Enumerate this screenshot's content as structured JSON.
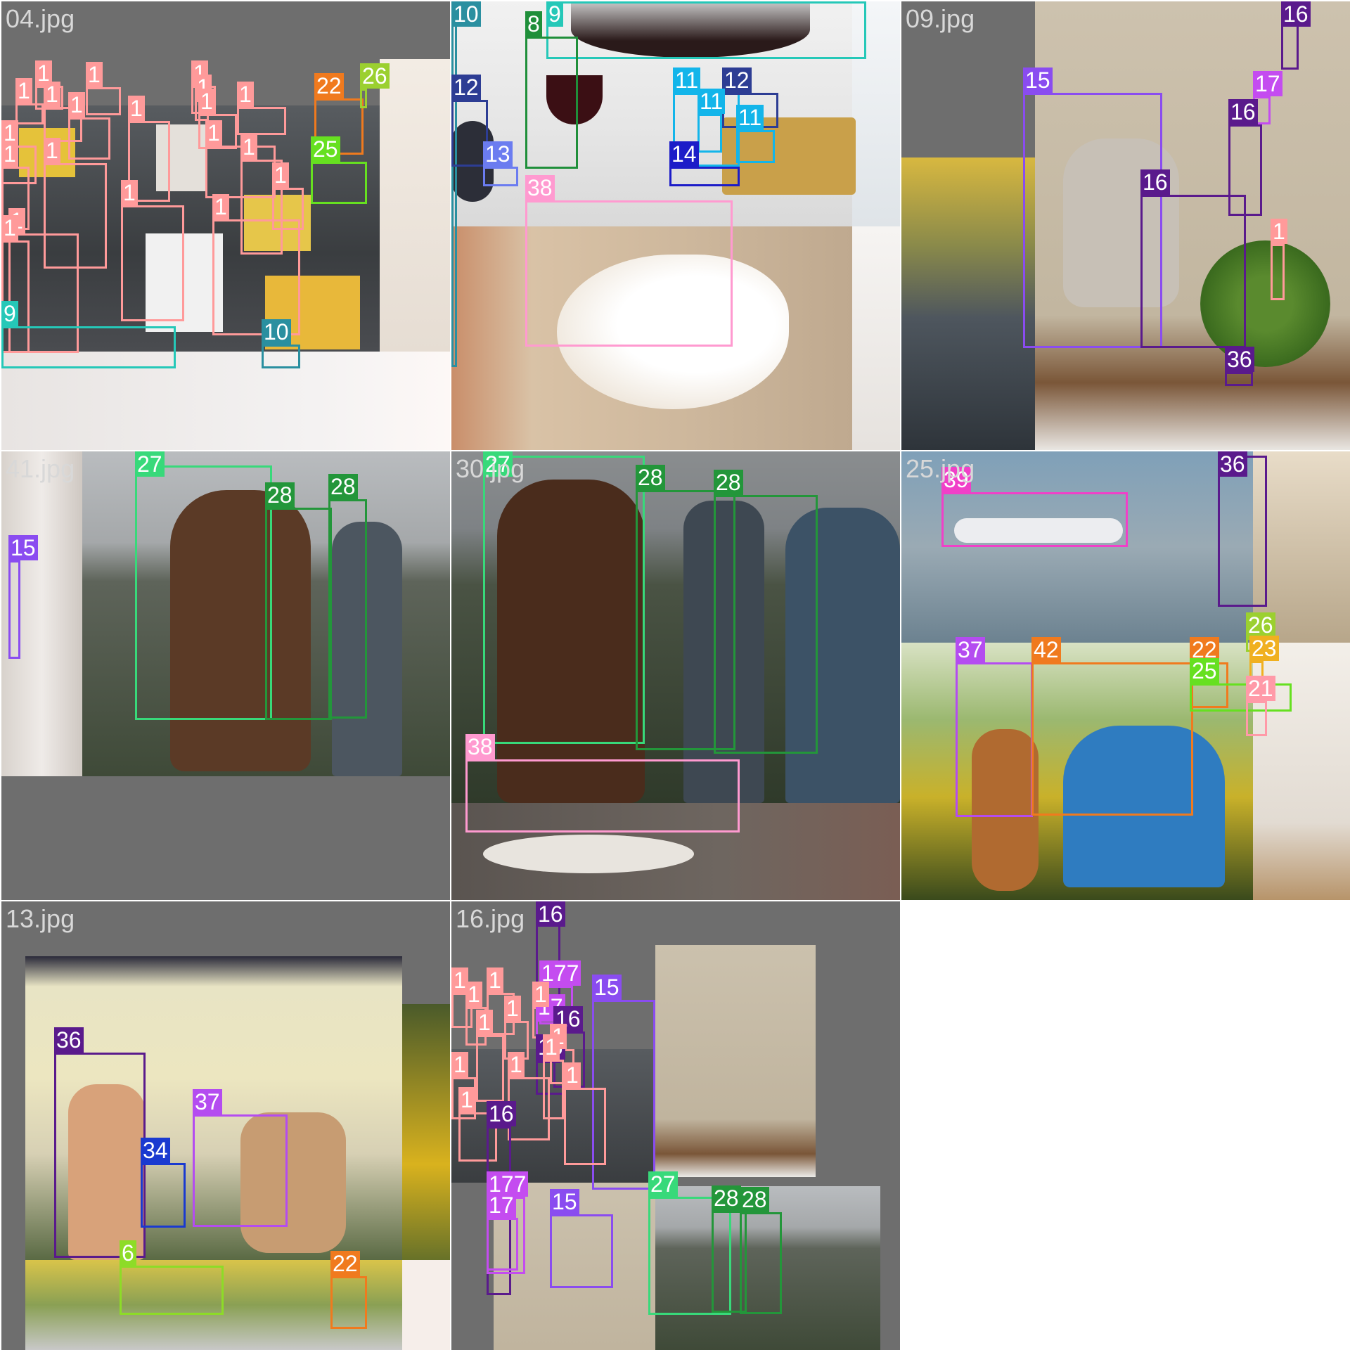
{
  "tiles": [
    {
      "title": "04.jpg"
    },
    {
      "title": ""
    },
    {
      "title": "09.jpg"
    },
    {
      "title": "41.jpg"
    },
    {
      "title": "30.jpg"
    },
    {
      "title": "25.jpg"
    },
    {
      "title": "13.jpg"
    },
    {
      "title": "16.jpg"
    }
  ],
  "palette": {
    "1": "#ff9a9a",
    "6": "#8ddc27",
    "8": "#1f8f3a",
    "9": "#25c8b8",
    "10": "#2a8fa0",
    "11": "#13b5ea",
    "12": "#2d3d94",
    "13": "#6b7cf0",
    "14": "#1c1cc8",
    "15": "#8a4cf0",
    "16": "#5a1a8c",
    "17": "#c44cf0",
    "21": "#ff9aa8",
    "22": "#f07a1e",
    "23": "#f0b020",
    "25": "#66e020",
    "26": "#9bd030",
    "27": "#38d97a",
    "28": "#23963a",
    "34": "#1a3ad0",
    "36": "#5a1a8c",
    "37": "#b44cf0",
    "38": "#ff9ad0",
    "39": "#f040c8",
    "42": "#f07a1e"
  },
  "labels": {
    "t0": [
      "1",
      "1",
      "1",
      "1",
      "1",
      "1",
      "1",
      "1",
      "1",
      "1",
      "1",
      "1",
      "1",
      "1",
      "1",
      "1",
      "1",
      "1",
      "1",
      "1",
      "22",
      "26",
      "25",
      "9",
      "10"
    ],
    "t1": [
      "10",
      "9",
      "8",
      "12",
      "13",
      "11",
      "12",
      "11",
      "11",
      "14",
      "38"
    ],
    "t2": [
      "16",
      "15",
      "17",
      "16",
      "16",
      "1",
      "36"
    ],
    "t3": [
      "27",
      "28",
      "28",
      "15"
    ],
    "t4": [
      "27",
      "28",
      "28",
      "38"
    ],
    "t5": [
      "39",
      "37",
      "42",
      "22",
      "26",
      "23",
      "25",
      "21",
      "36"
    ],
    "t6": [
      "36",
      "37",
      "34",
      "6",
      "22"
    ],
    "t7": [
      "16",
      "177",
      "17",
      "16",
      "16",
      "15",
      "1",
      "1",
      "1",
      "1",
      "1",
      "1",
      "1",
      "1",
      "1",
      "1",
      "1",
      "1",
      "16",
      "177",
      "17",
      "15",
      "27",
      "28",
      "28"
    ]
  }
}
